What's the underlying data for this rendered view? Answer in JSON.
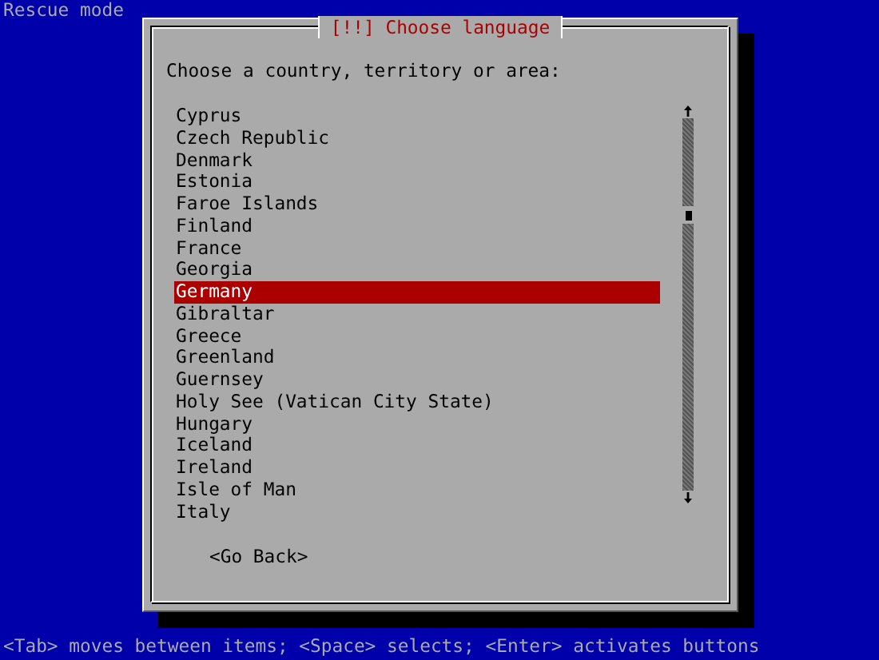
{
  "screen_title": "Rescue mode",
  "dialog": {
    "title": "[!!] Choose language",
    "prompt": "Choose a country, territory or area:",
    "items": [
      {
        "label": "Cyprus",
        "selected": false
      },
      {
        "label": "Czech Republic",
        "selected": false
      },
      {
        "label": "Denmark",
        "selected": false
      },
      {
        "label": "Estonia",
        "selected": false
      },
      {
        "label": "Faroe Islands",
        "selected": false
      },
      {
        "label": "Finland",
        "selected": false
      },
      {
        "label": "France",
        "selected": false
      },
      {
        "label": "Georgia",
        "selected": false
      },
      {
        "label": "Germany",
        "selected": true
      },
      {
        "label": "Gibraltar",
        "selected": false
      },
      {
        "label": "Greece",
        "selected": false
      },
      {
        "label": "Greenland",
        "selected": false
      },
      {
        "label": "Guernsey",
        "selected": false
      },
      {
        "label": "Holy See (Vatican City State)",
        "selected": false
      },
      {
        "label": "Hungary",
        "selected": false
      },
      {
        "label": "Iceland",
        "selected": false
      },
      {
        "label": "Ireland",
        "selected": false
      },
      {
        "label": "Isle of Man",
        "selected": false
      },
      {
        "label": "Italy",
        "selected": false
      }
    ],
    "buttons": [
      "<Go Back>"
    ]
  },
  "status_bar": "<Tab> moves between items; <Space> selects; <Enter> activates buttons"
}
